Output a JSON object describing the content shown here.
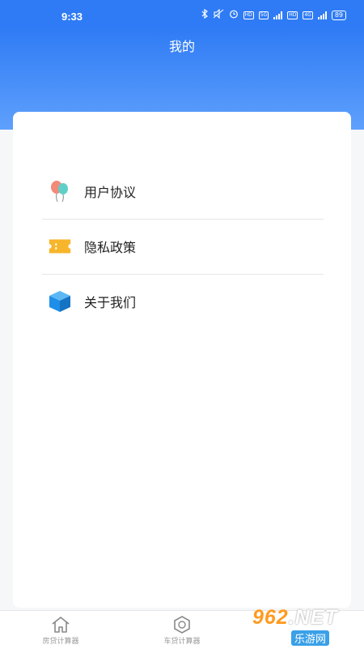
{
  "status_bar": {
    "time": "9:33",
    "network_badge_1": "5G",
    "hd_badge": "HD",
    "network_badge_2": "4G",
    "battery": "89"
  },
  "header": {
    "title": "我的"
  },
  "menu": {
    "items": [
      {
        "label": "用户协议",
        "icon": "balloon-icon"
      },
      {
        "label": "隐私政策",
        "icon": "ticket-icon"
      },
      {
        "label": "关于我们",
        "icon": "cube-icon"
      }
    ]
  },
  "tabbar": {
    "tabs": [
      {
        "label": "房贷计算器",
        "icon": "home-icon"
      },
      {
        "label": "车贷计算器",
        "icon": "car-icon"
      }
    ]
  },
  "watermark": {
    "brand": "962",
    "suffix": ".NET",
    "sub": "乐游网"
  },
  "colors": {
    "primary": "#2f7bf5",
    "header_bottom": "#5ea0fc",
    "ticket": "#f7b52b",
    "cube": "#1e8fe8"
  }
}
